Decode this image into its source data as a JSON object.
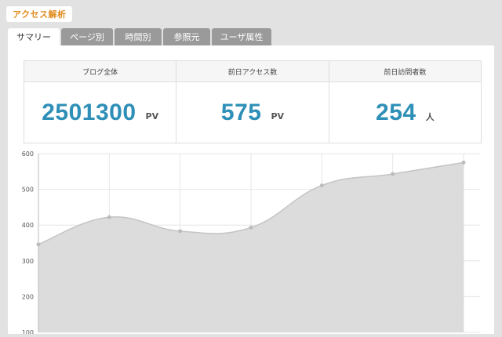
{
  "header": {
    "title": "アクセス解析"
  },
  "tabs": [
    {
      "label": "サマリー",
      "active": true
    },
    {
      "label": "ページ別",
      "active": false
    },
    {
      "label": "時間別",
      "active": false
    },
    {
      "label": "参照元",
      "active": false
    },
    {
      "label": "ユーザ属性",
      "active": false
    }
  ],
  "stats": [
    {
      "label": "ブログ全体",
      "value": "2501300",
      "unit": "PV"
    },
    {
      "label": "前日アクセス数",
      "value": "575",
      "unit": "PV"
    },
    {
      "label": "前日訪問者数",
      "value": "254",
      "unit": "人"
    }
  ],
  "colors": {
    "accent": "#2e8fb7",
    "badge": "#e08a1c",
    "area": "#dcdcdc",
    "line": "#c4c4c4"
  },
  "chart_data": {
    "type": "area",
    "x": [
      1,
      2,
      3,
      4,
      5,
      6,
      7
    ],
    "values": [
      346,
      422,
      383,
      393,
      511,
      543,
      575
    ],
    "ylim": [
      100,
      600
    ],
    "yticks": [
      100,
      200,
      300,
      400,
      500,
      600
    ],
    "grid": true,
    "title": "",
    "xlabel": "",
    "ylabel": ""
  }
}
